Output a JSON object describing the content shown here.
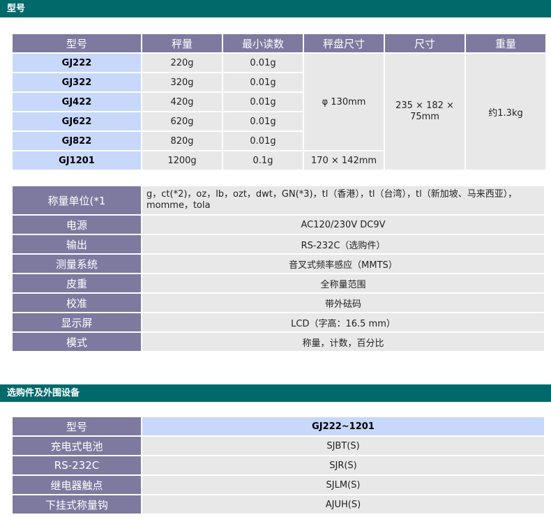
{
  "sections": {
    "model": "型号",
    "accessories": "选购件及外围设备"
  },
  "table1": {
    "headers": [
      "型号",
      "秤量",
      "最小读数",
      "秤盘尺寸",
      "尺寸",
      "重量"
    ],
    "rows": [
      {
        "model": "GJ222",
        "capacity": "220g",
        "readability": "0.01g"
      },
      {
        "model": "GJ322",
        "capacity": "320g",
        "readability": "0.01g"
      },
      {
        "model": "GJ422",
        "capacity": "420g",
        "readability": "0.01g"
      },
      {
        "model": "GJ622",
        "capacity": "620g",
        "readability": "0.01g"
      },
      {
        "model": "GJ822",
        "capacity": "820g",
        "readability": "0.01g"
      },
      {
        "model": "GJ1201",
        "capacity": "1200g",
        "readability": "0.1g"
      }
    ],
    "pan_small": "φ 130mm",
    "pan_large": "170 × 142mm",
    "dimensions": "235 × 182 × 75mm",
    "weight": "约1.3kg"
  },
  "table2": {
    "rows": [
      {
        "label": "称量单位(*1",
        "value": "g，ct(*2)，oz，lb，ozt，dwt，GN(*3)，tl（香港），tl（台湾），tl（新加坡、马来西亚），momme，tola"
      },
      {
        "label": "电源",
        "value": "AC120/230V DC9V"
      },
      {
        "label": "输出",
        "value": "RS-232C（选购件）"
      },
      {
        "label": "测量系统",
        "value": "音叉式频率感应（MMTS）"
      },
      {
        "label": "皮重",
        "value": "全称量范围"
      },
      {
        "label": "校准",
        "value": "带外砝码"
      },
      {
        "label": "显示屏",
        "value": "LCD（字高：16.5 mm）"
      },
      {
        "label": "模式",
        "value": "称量，计数，百分比"
      }
    ]
  },
  "table3": {
    "header_label": "型号",
    "header_value": "GJ222~1201",
    "rows": [
      {
        "label": "充电式电池",
        "value": "SJBT(S)"
      },
      {
        "label": "RS-232C",
        "value": "SJR(S)"
      },
      {
        "label": "继电器触点",
        "value": "SJLM(S)"
      },
      {
        "label": "下挂式称量钩",
        "value": "AJUH(S)"
      }
    ]
  }
}
